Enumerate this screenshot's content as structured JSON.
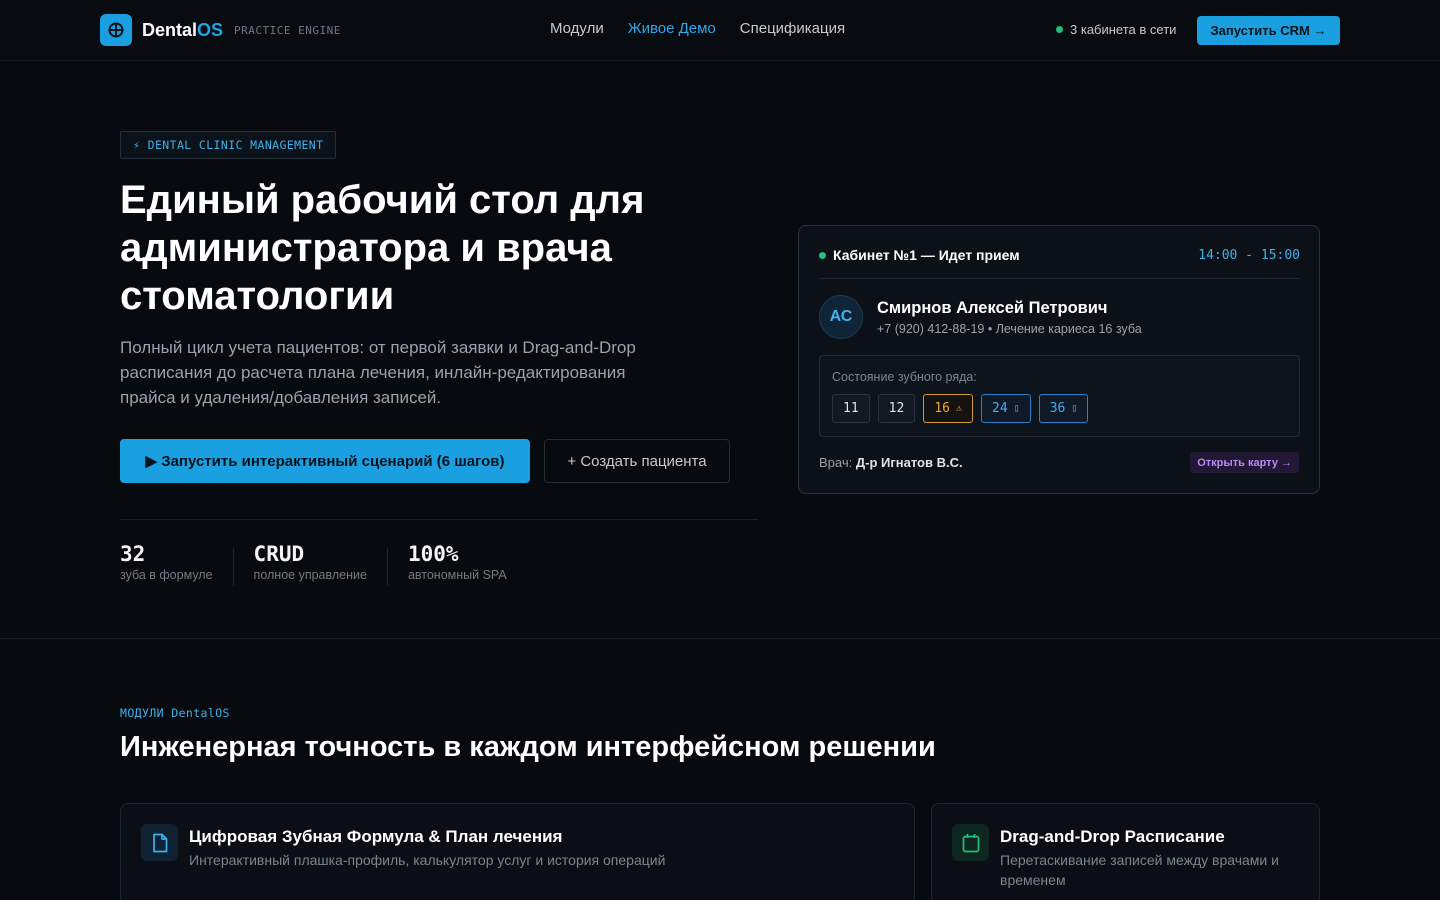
{
  "nav": {
    "brand_name": "Dental",
    "brand_accent": "OS",
    "brand_tag": "PRACTICE ENGINE",
    "links": [
      {
        "label": "Модули"
      },
      {
        "label": "Живое Демо"
      },
      {
        "label": "Спецификация"
      }
    ],
    "active_link": "Живое Демо",
    "online_status": "3 кабинета в сети",
    "cta_label": "Запустить CRM →"
  },
  "hero": {
    "badge": "⚡ DENTAL CLINIC MANAGEMENT",
    "title": "Единый рабочий стол для администратора и врача стоматологии",
    "description": "Полный цикл учета пациентов: от первой заявки и Drag-and-Drop расписания до расчета плана лечения, инлайн-редактирования прайса и удаления/добавления записей.",
    "primary_button": "▶ Запустить интерактивный сценарий (6 шагов)",
    "secondary_button": "+ Создать пациента",
    "stats": [
      {
        "value": "32",
        "label": "зуба в формуле"
      },
      {
        "value": "CRUD",
        "label": "полное управление"
      },
      {
        "value": "100%",
        "label": "автономный SPA"
      }
    ]
  },
  "appointment": {
    "room": "Кабинет №1 — Идет прием",
    "time": "14:00 - 15:00",
    "avatar_initials": "АС",
    "patient_name": "Смирнов Алексей Петрович",
    "patient_info": "+7 (920) 412-88-19 • Лечение кариеса 16 зуба",
    "teeth_label": "Состояние зубного ряда:",
    "teeth": [
      {
        "number": "11",
        "status": "normal",
        "icon": ""
      },
      {
        "number": "12",
        "status": "normal",
        "icon": ""
      },
      {
        "number": "16",
        "status": "warning",
        "icon": "⚠"
      },
      {
        "number": "24",
        "status": "treated",
        "icon": "▯"
      },
      {
        "number": "36",
        "status": "treated",
        "icon": "▯"
      }
    ],
    "doctor_prefix": "Врач:",
    "doctor_name": "Д-р Игнатов В.С.",
    "open_card_label": "Открыть карту →"
  },
  "modules": {
    "kicker": "МОДУЛИ DentalOS",
    "title": "Инженерная точность в каждом интерфейсном решении",
    "items": [
      {
        "icon": "document-icon",
        "name": "Цифровая Зубная Формула & План лечения",
        "description": "Интерактивный плашка-профиль, калькулятор услуг и история операций"
      },
      {
        "icon": "calendar-icon",
        "name": "Drag-and-Drop Расписание",
        "description": "Перетаскивание записей между врачами и временем"
      }
    ]
  },
  "colors": {
    "accent": "#1a9fe0",
    "background": "#070a0f",
    "online": "#22c07a",
    "warning": "#d39b27",
    "purple": "#b48bf4"
  }
}
